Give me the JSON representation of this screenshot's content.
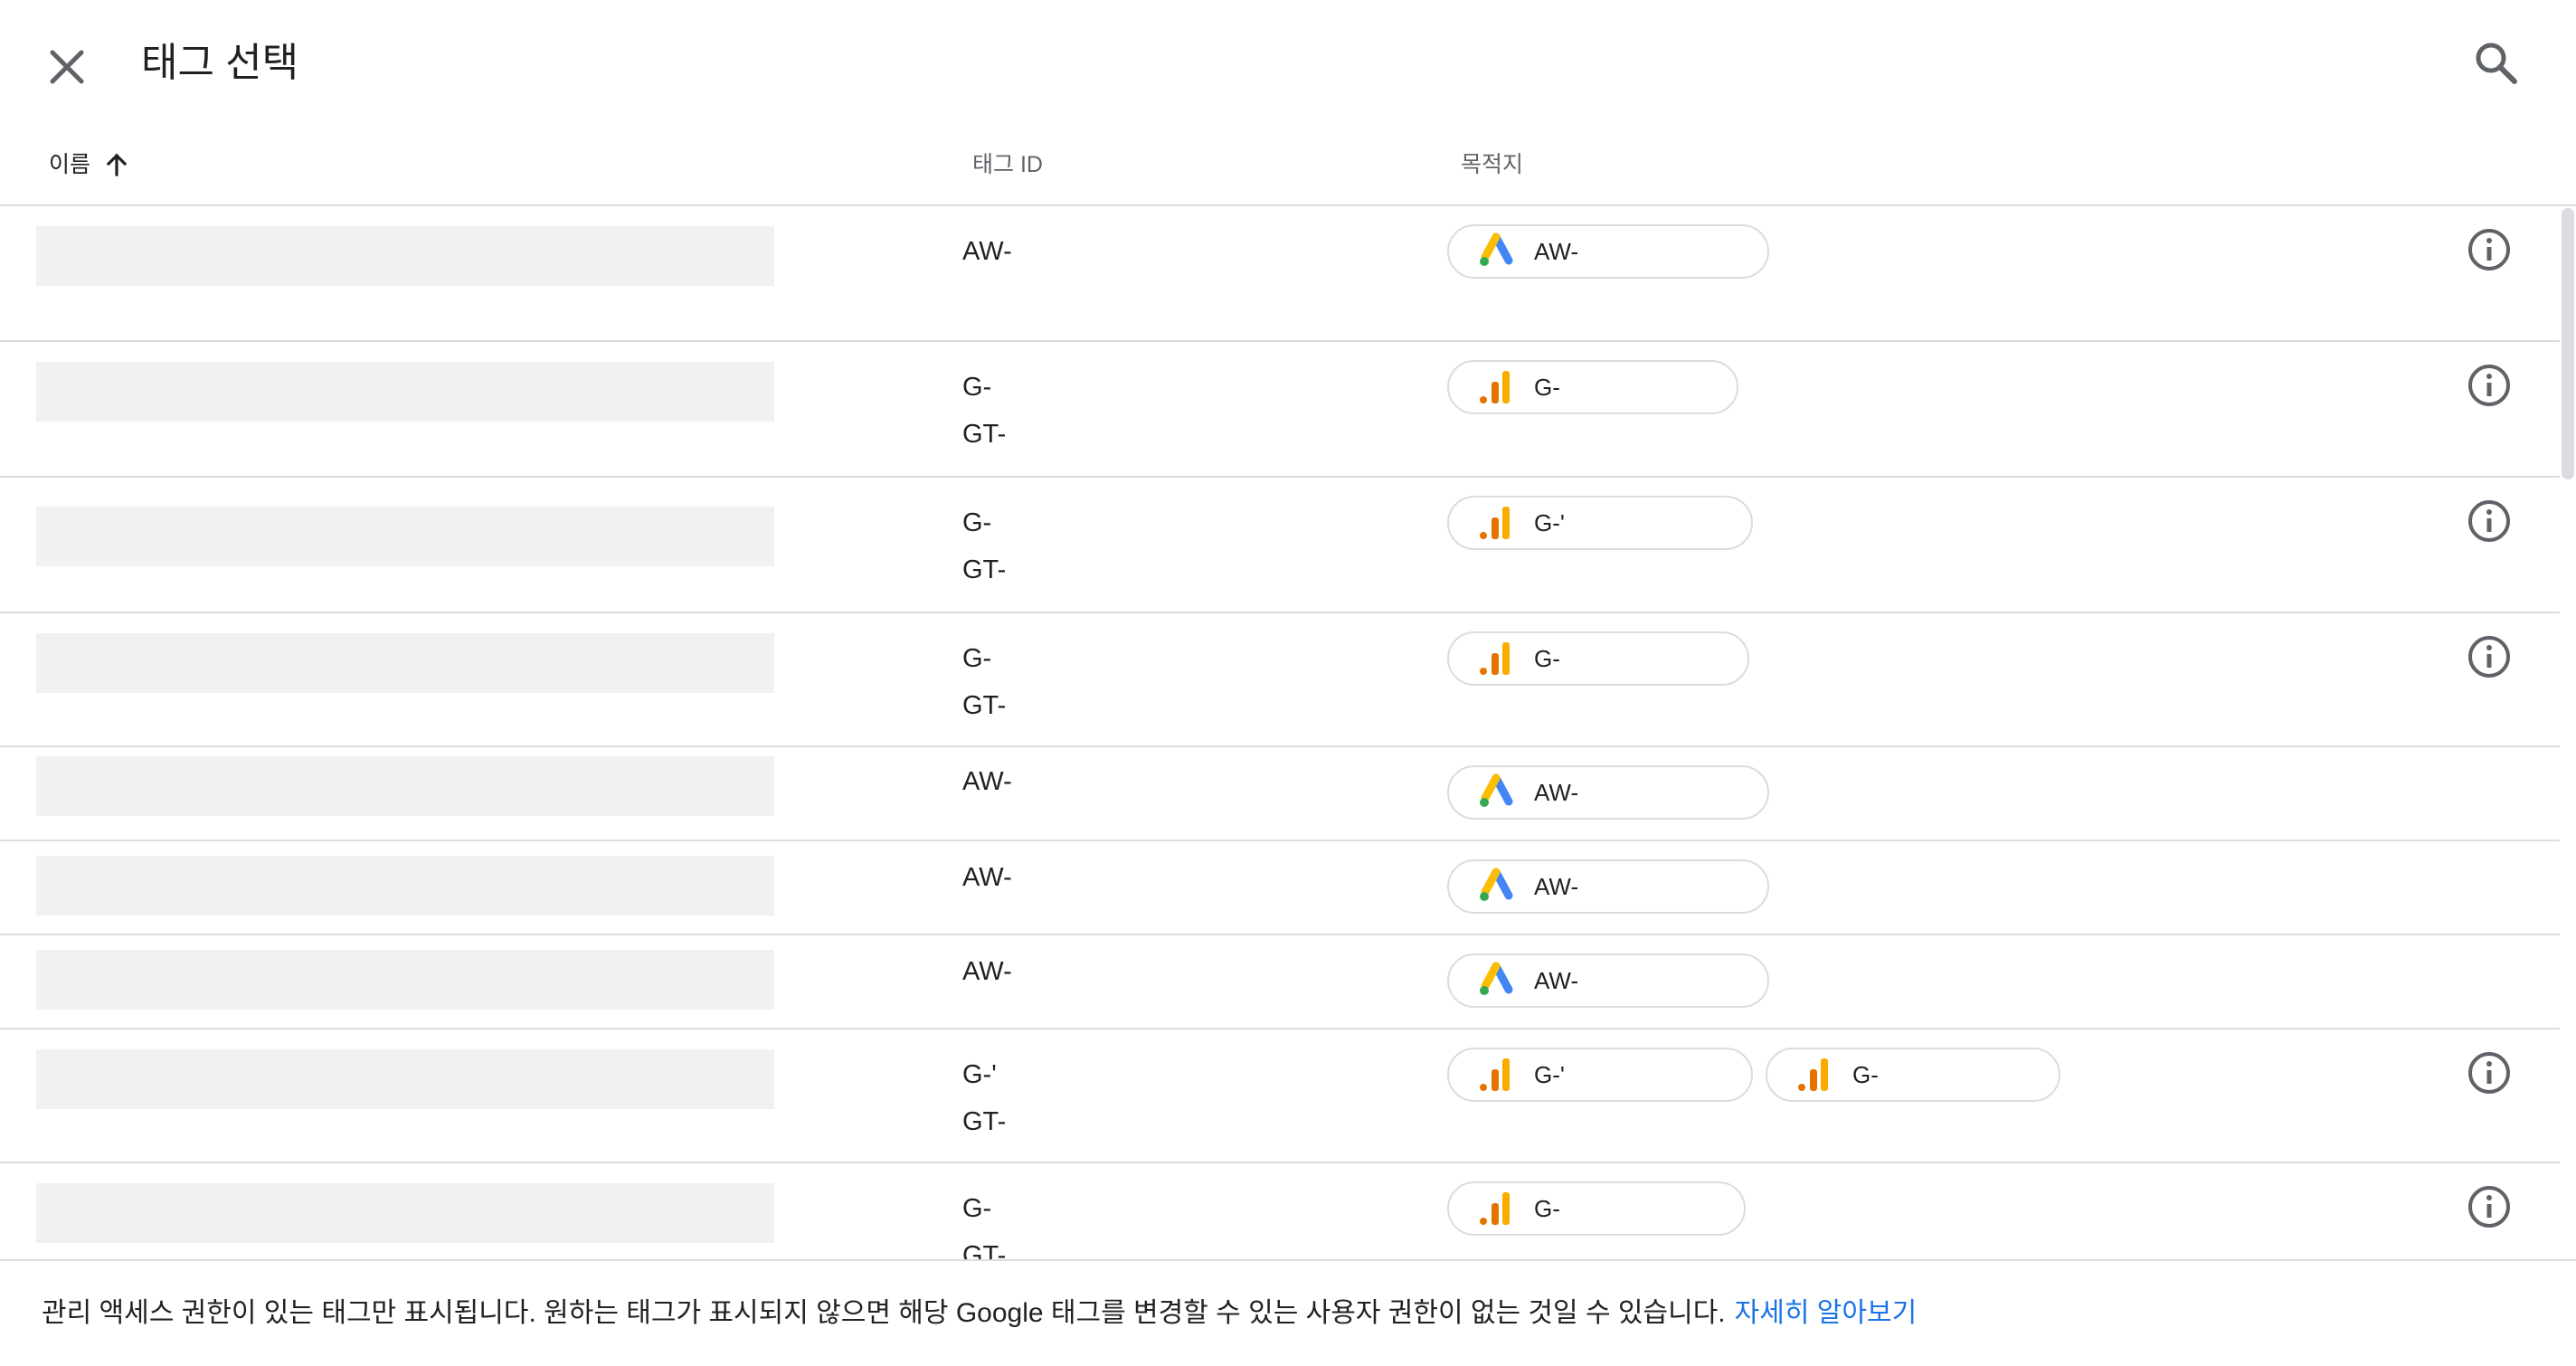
{
  "header": {
    "title": "태그 선택",
    "close_icon": "close-icon",
    "search_icon": "search-icon"
  },
  "columns": {
    "name": "이름",
    "tag_id": "태그 ID",
    "destination": "목적지",
    "sort_icon": "arrow-upward-icon"
  },
  "rows": [
    {
      "tag_ids": [
        "AW-"
      ],
      "destinations": [
        {
          "type": "google-ads",
          "label": "AW-"
        }
      ],
      "info": true
    },
    {
      "tag_ids": [
        "G-",
        "GT-"
      ],
      "destinations": [
        {
          "type": "analytics",
          "label": "G-"
        }
      ],
      "info": true
    },
    {
      "tag_ids": [
        "G-",
        "GT-"
      ],
      "destinations": [
        {
          "type": "analytics",
          "label": "G-'"
        }
      ],
      "info": true
    },
    {
      "tag_ids": [
        "G-",
        "GT-"
      ],
      "destinations": [
        {
          "type": "analytics",
          "label": "G-"
        }
      ],
      "info": true
    },
    {
      "tag_ids": [
        "AW-"
      ],
      "destinations": [
        {
          "type": "google-ads",
          "label": "AW-"
        }
      ],
      "info": false
    },
    {
      "tag_ids": [
        "AW-"
      ],
      "destinations": [
        {
          "type": "google-ads",
          "label": "AW-"
        }
      ],
      "info": false
    },
    {
      "tag_ids": [
        "AW-"
      ],
      "destinations": [
        {
          "type": "google-ads",
          "label": "AW-"
        }
      ],
      "info": false
    },
    {
      "tag_ids": [
        "G-'",
        "GT-"
      ],
      "destinations": [
        {
          "type": "analytics",
          "label": "G-'"
        },
        {
          "type": "analytics",
          "label": "G-"
        }
      ],
      "info": true
    },
    {
      "tag_ids": [
        "G-",
        "GT-"
      ],
      "destinations": [
        {
          "type": "analytics",
          "label": "G-"
        }
      ],
      "info": true
    }
  ],
  "footer": {
    "text": "관리 액세스 권한이 있는 태그만 표시됩니다. 원하는 태그가 표시되지 않으면 해당 Google 태그를 변경할 수 있는 사용자 권한이 없는 것일 수 있습니다.",
    "link": "자세히 알아보기"
  },
  "colors": {
    "link": "#1a73e8",
    "divider": "#dadce0",
    "ads_blue": "#4285f4",
    "ads_yellow": "#fbbc04",
    "ads_green": "#34a853",
    "analytics_orange": "#f9ab00",
    "analytics_dark": "#e37400"
  }
}
